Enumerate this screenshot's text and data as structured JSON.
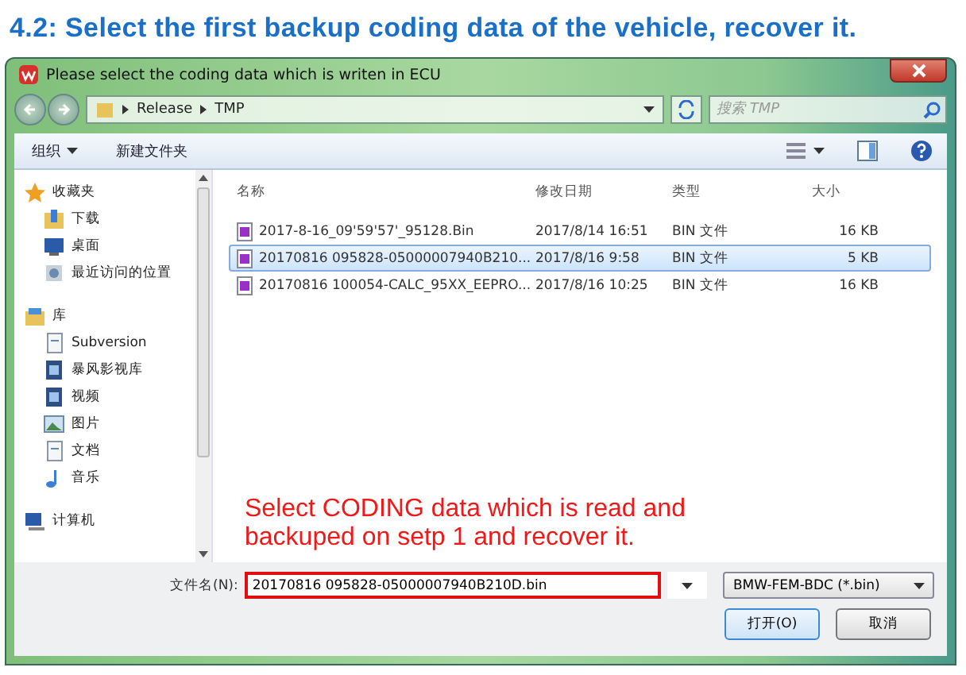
{
  "heading": "4.2: Select the first backup coding data of the vehicle, recover it.",
  "window": {
    "title": "Please select the coding data which is writen in ECU"
  },
  "address": {
    "path": [
      "Release",
      "TMP"
    ],
    "search_placeholder": "搜索 TMP"
  },
  "toolbar": {
    "organize": "组织",
    "new_folder": "新建文件夹"
  },
  "sidebar": {
    "items": [
      {
        "label": "收藏夹",
        "kind": "star",
        "children": [
          {
            "label": "下载",
            "kind": "download"
          },
          {
            "label": "桌面",
            "kind": "desktop"
          },
          {
            "label": "最近访问的位置",
            "kind": "recent"
          }
        ]
      },
      {
        "label": "库",
        "kind": "library",
        "children": [
          {
            "label": "Subversion",
            "kind": "doc"
          },
          {
            "label": "暴风影视库",
            "kind": "video"
          },
          {
            "label": "视频",
            "kind": "video"
          },
          {
            "label": "图片",
            "kind": "image"
          },
          {
            "label": "文档",
            "kind": "doc"
          },
          {
            "label": "音乐",
            "kind": "music"
          }
        ]
      },
      {
        "label": "计算机",
        "kind": "computer"
      }
    ]
  },
  "table": {
    "columns": [
      "名称",
      "修改日期",
      "类型",
      "大小"
    ],
    "rows": [
      {
        "cells": [
          "2017-8-16_09'59'57'_95128.Bin",
          "2017/8/14 16:51",
          "BIN 文件",
          "16 KB"
        ],
        "selected": false
      },
      {
        "cells": [
          "20170816 095828-05000007940B210...",
          "2017/8/16 9:58",
          "BIN 文件",
          "5 KB"
        ],
        "selected": true
      },
      {
        "cells": [
          "20170816 100054-CALC_95XX_EEPRO...",
          "2017/8/16 10:25",
          "BIN 文件",
          "16 KB"
        ],
        "selected": false
      }
    ]
  },
  "annotation": "Select CODING data which is read and backuped on setp 1 and recover it.",
  "filename": {
    "label": "文件名(N):",
    "value": "20170816 095828-05000007940B210D.bin"
  },
  "filetype": "BMW-FEM-BDC (*.bin)",
  "buttons": [
    "打开(O)",
    "取消"
  ]
}
